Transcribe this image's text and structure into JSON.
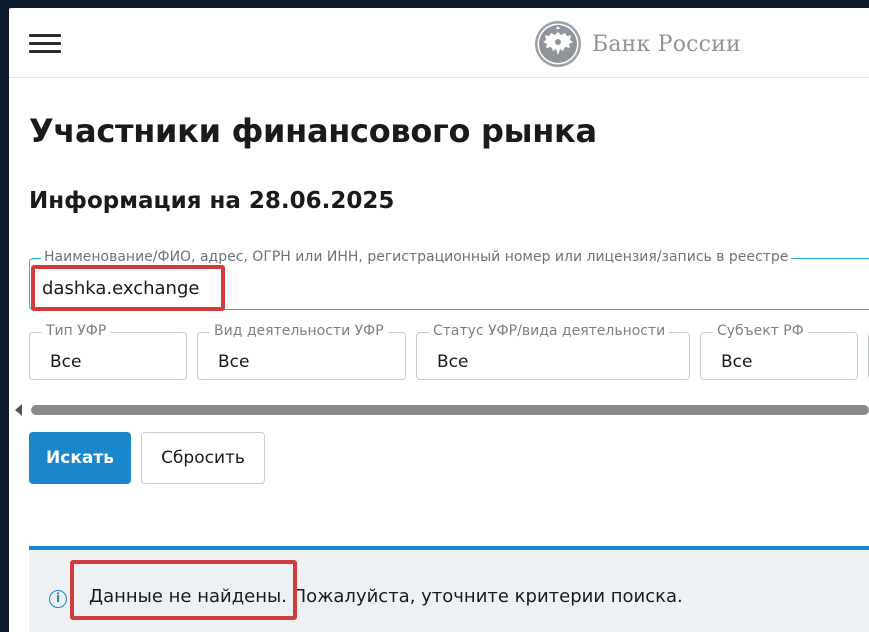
{
  "header": {
    "brand_name": "Банк России",
    "menu_icon": "hamburger-icon",
    "emblem_icon": "double-headed-eagle-icon"
  },
  "main": {
    "title": "Участники финансового рынка",
    "info_date": "Информация на 28.06.2025",
    "search": {
      "label": "Наименование/ФИО, адрес, ОГРН или ИНН, регистрационный номер или лицензия/запись в реестре",
      "value": "dashka.exchange"
    },
    "filters": [
      {
        "label": "Тип УФР",
        "value": "Все"
      },
      {
        "label": "Вид деятельности УФР",
        "value": "Все"
      },
      {
        "label": "Статус УФР/вида деятельности",
        "value": "Все"
      },
      {
        "label": "Субъект РФ",
        "value": "Все"
      }
    ],
    "buttons": {
      "search_label": "Искать",
      "reset_label": "Сбросить"
    },
    "alert": {
      "icon": "info-icon",
      "text": "Данные не найдены. Пожалуйста, уточните критерии поиска."
    }
  },
  "colors": {
    "accent": "#1a86cc",
    "field_focus": "#1eb7d8",
    "annotation": "#d23c3c"
  }
}
